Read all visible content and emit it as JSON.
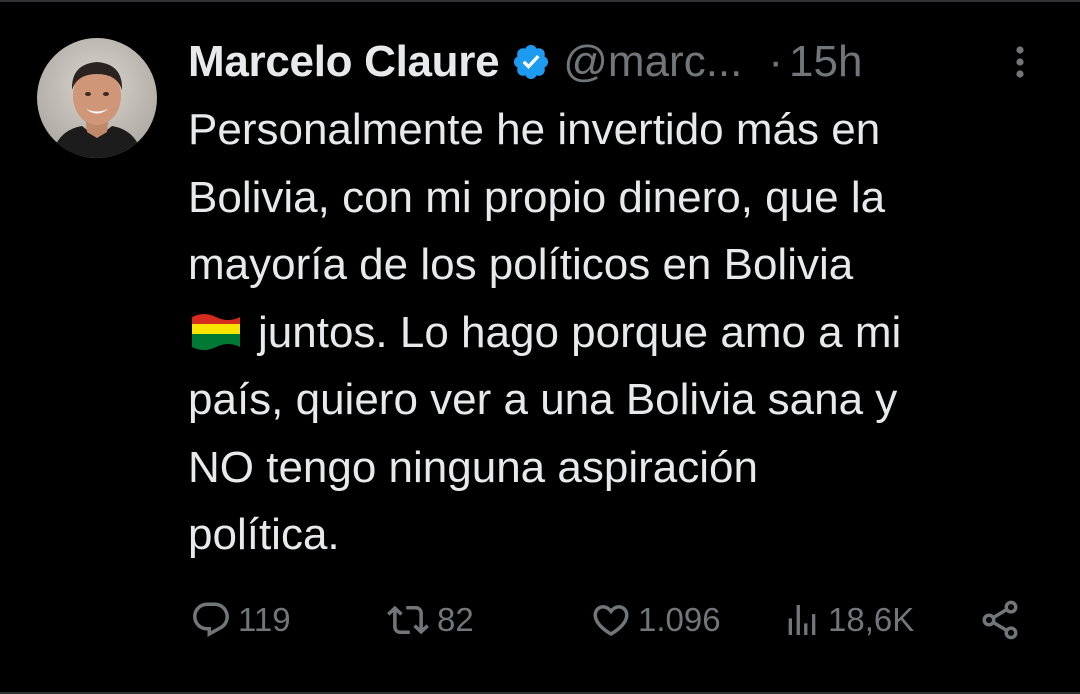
{
  "tweet": {
    "display_name": "Marcelo Claure",
    "handle": "@marc...",
    "separator": "·",
    "time": "15h",
    "body_lines": [
      "Personalmente he invertido más en",
      "Bolivia, con mi propio dinero, que la",
      "mayoría de los políticos en Bolivia",
      "juntos.  Lo hago porque amo a mi",
      "país, quiero ver a una Bolivia sana y",
      "NO tengo ninguna aspiración",
      "política."
    ],
    "flag_emoji": "bolivia-flag-icon"
  },
  "actions": {
    "replies": "119",
    "retweets": "82",
    "likes": "1.096",
    "views": "18,6K"
  },
  "colors": {
    "background": "#000000",
    "text": "#e7e9ea",
    "muted": "#71767b",
    "verified_blue": "#1d9bf0",
    "border": "#2f3336"
  },
  "icons": [
    "verified-badge-icon",
    "more-options-icon",
    "reply-icon",
    "retweet-icon",
    "like-icon",
    "views-icon",
    "share-icon"
  ]
}
